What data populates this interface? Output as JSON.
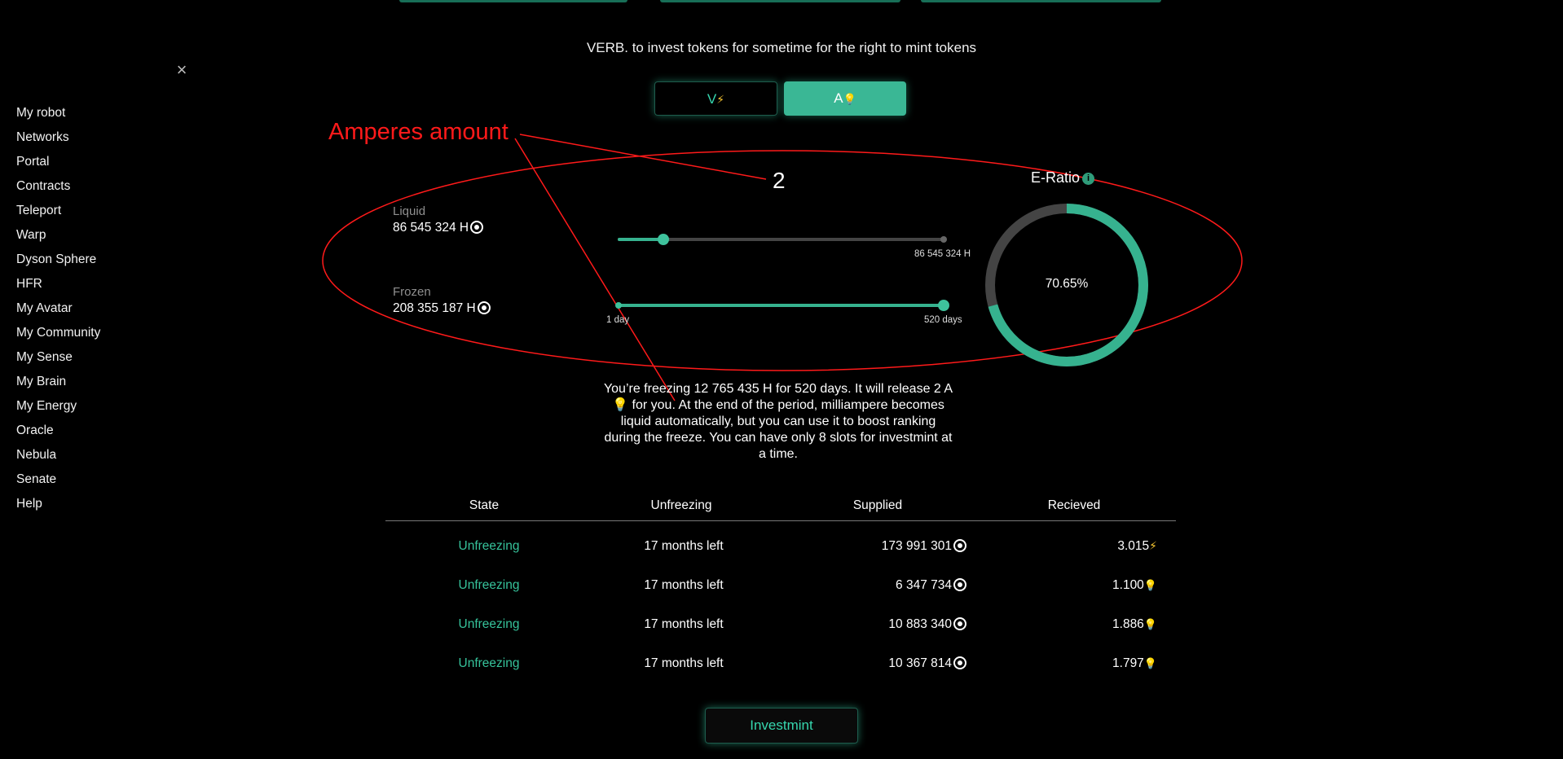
{
  "sidebar": {
    "close_icon": "close-icon",
    "items": [
      {
        "label": "My robot"
      },
      {
        "label": "Networks"
      },
      {
        "label": "Portal"
      },
      {
        "label": "Contracts"
      },
      {
        "label": "Teleport"
      },
      {
        "label": "Warp"
      },
      {
        "label": "Dyson Sphere"
      },
      {
        "label": "HFR"
      },
      {
        "label": "My Avatar"
      },
      {
        "label": "My Community"
      },
      {
        "label": "My Sense"
      },
      {
        "label": "My Brain"
      },
      {
        "label": "My Energy"
      },
      {
        "label": "Oracle"
      },
      {
        "label": "Nebula"
      },
      {
        "label": "Senate"
      },
      {
        "label": "Help"
      }
    ]
  },
  "header": {
    "verb": "VERB. to invest tokens for sometime for the right to mint tokens"
  },
  "toggle": {
    "v_label": "V",
    "v_icon": "⚡",
    "a_label": "A",
    "a_icon": "💡",
    "selected": "A"
  },
  "annotation": {
    "label": "Amperes amount",
    "value": "2",
    "color": "#ff1a1a"
  },
  "form": {
    "liquid_label": "Liquid",
    "liquid_value": "86 545 324 H",
    "frozen_label": "Frozen",
    "frozen_value": "208 355 187 H",
    "amount_slider": {
      "value_fraction": 0.14,
      "max_caption": "86 545 324 H"
    },
    "days_slider": {
      "value_fraction": 1.0,
      "min_caption": "1 day",
      "max_caption": "520 days"
    }
  },
  "eratio": {
    "title": "E-Ratio",
    "info_icon": "info-icon",
    "percent_text": "70.65%",
    "fraction": 0.7065
  },
  "description": "You’re freezing 12 765 435 H for 520 days. It will release 2 A💡 for you. At the end of the period, milliampere becomes liquid automatically, but you can use it to boost ranking during the freeze. You can have only 8 slots for investmint at a time.",
  "table": {
    "headers": [
      "State",
      "Unfreezing",
      "Supplied",
      "Recieved"
    ],
    "rows": [
      {
        "state": "Unfreezing",
        "unfreezing": "17 months left",
        "supplied": "173 991 301",
        "received": "3.015",
        "received_icon": "⚡"
      },
      {
        "state": "Unfreezing",
        "unfreezing": "17 months left",
        "supplied": "6 347 734",
        "received": "1.100",
        "received_icon": "💡"
      },
      {
        "state": "Unfreezing",
        "unfreezing": "17 months left",
        "supplied": "10 883 340",
        "received": "1.886",
        "received_icon": "💡"
      },
      {
        "state": "Unfreezing",
        "unfreezing": "17 months left",
        "supplied": "10 367 814",
        "received": "1.797",
        "received_icon": "💡"
      }
    ]
  },
  "action": {
    "button_label": "Investmint"
  },
  "colors": {
    "accent": "#36c39b",
    "accent_fill": "#3ab795",
    "background": "#000000",
    "annotation": "#ff1a1a"
  }
}
